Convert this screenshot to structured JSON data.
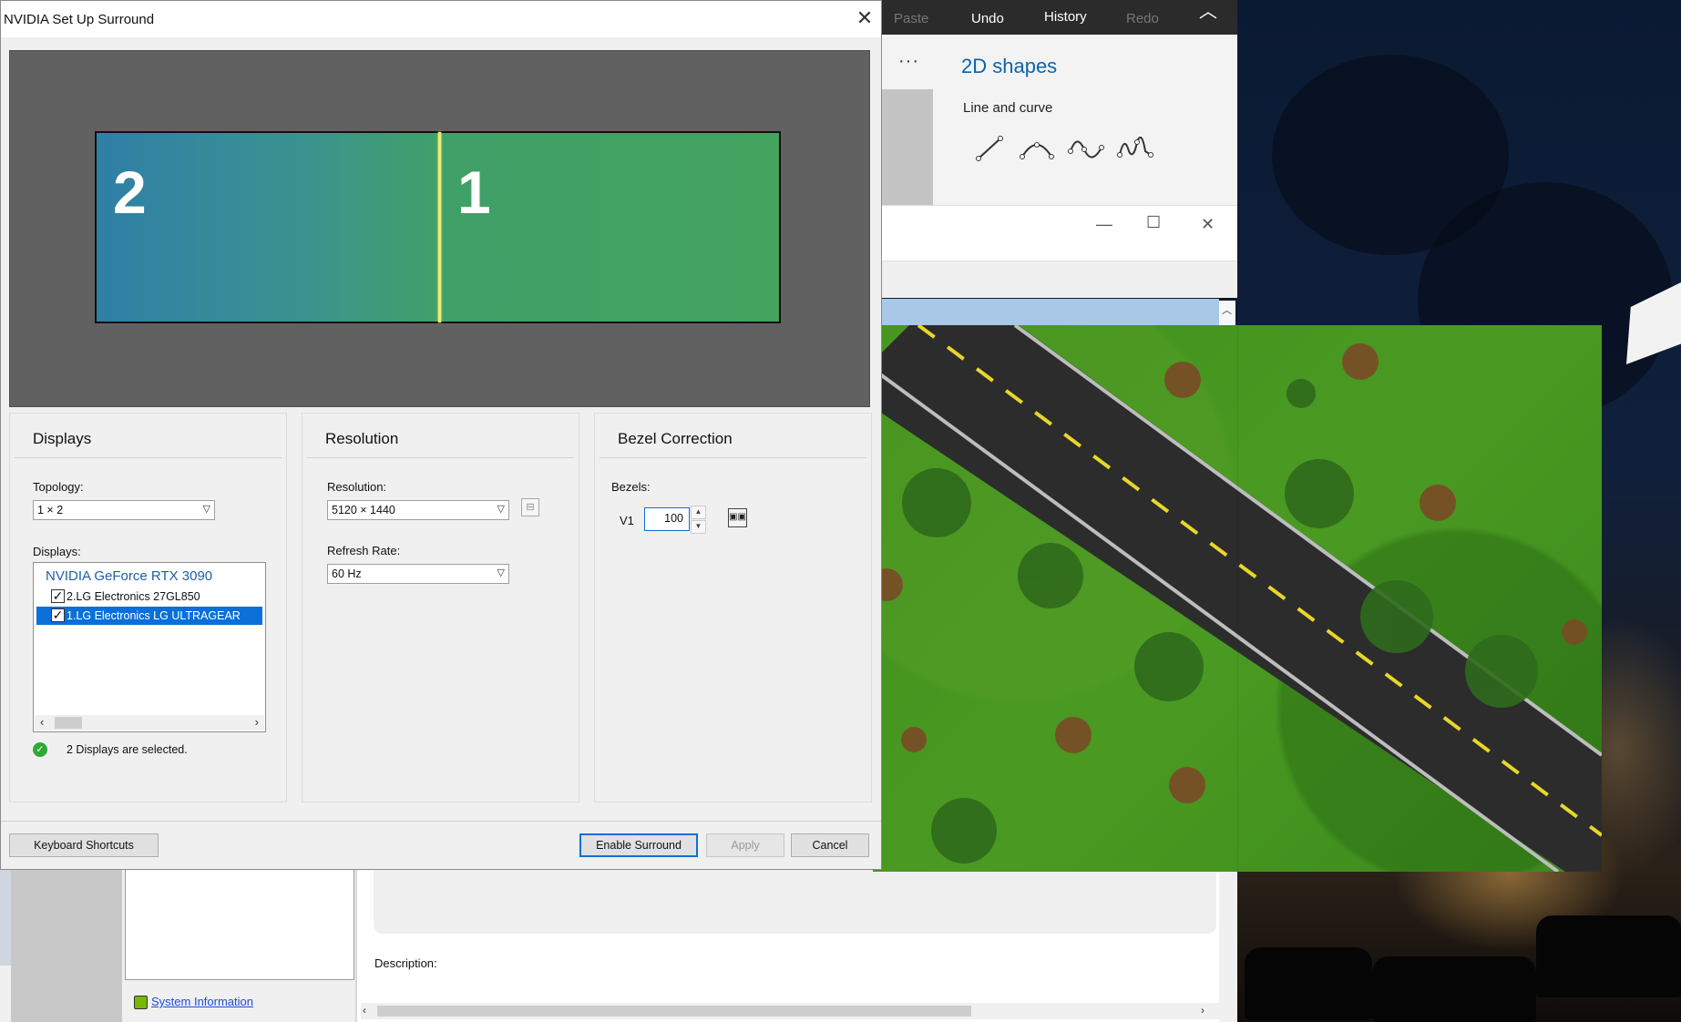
{
  "dialog": {
    "title": "NVIDIA Set Up Surround",
    "close_glyph": "✕",
    "monitor_left_label": "2",
    "monitor_right_label": "1",
    "displays": {
      "group_title": "Displays",
      "topology_label": "Topology:",
      "topology_value": "1 × 2",
      "displays_label": "Displays:",
      "gpu_name": "NVIDIA GeForce RTX 3090",
      "items": [
        {
          "label": "2.LG Electronics 27GL850",
          "checked": true,
          "selected": false
        },
        {
          "label": "1.LG Electronics LG ULTRAGEAR",
          "checked": true,
          "selected": true
        }
      ],
      "status_text": "2 Displays are selected."
    },
    "resolution": {
      "group_title": "Resolution",
      "resolution_label": "Resolution:",
      "resolution_value": "5120 × 1440",
      "refresh_label": "Refresh Rate:",
      "refresh_value": "60  Hz"
    },
    "bezel": {
      "group_title": "Bezel Correction",
      "bezels_label": "Bezels:",
      "v1_label": "V1",
      "v1_value": "100"
    },
    "buttons": {
      "keyboard_shortcuts": "Keyboard Shortcuts",
      "enable_surround": "Enable Surround",
      "apply": "Apply",
      "cancel": "Cancel"
    }
  },
  "paint": {
    "ribbon": {
      "paste": "Paste",
      "undo": "Undo",
      "history": "History",
      "redo": "Redo"
    },
    "more_glyph": "···",
    "panel_title": "2D shapes",
    "section_label": "Line and curve"
  },
  "control_panel": {
    "system_information": "System Information",
    "description_label": "Description:"
  },
  "colors": {
    "nvidia_green": "#76b900",
    "selection_blue": "#0a6fd8",
    "paint_accent": "#0a64ad"
  },
  "icons": [
    "close-icon",
    "chevron-down-icon",
    "checkmark-icon",
    "success-icon",
    "spin-up-icon",
    "spin-down-icon",
    "bezel-peek-icon",
    "line-icon",
    "curve-icon",
    "wave-icon",
    "zigzag-icon"
  ]
}
